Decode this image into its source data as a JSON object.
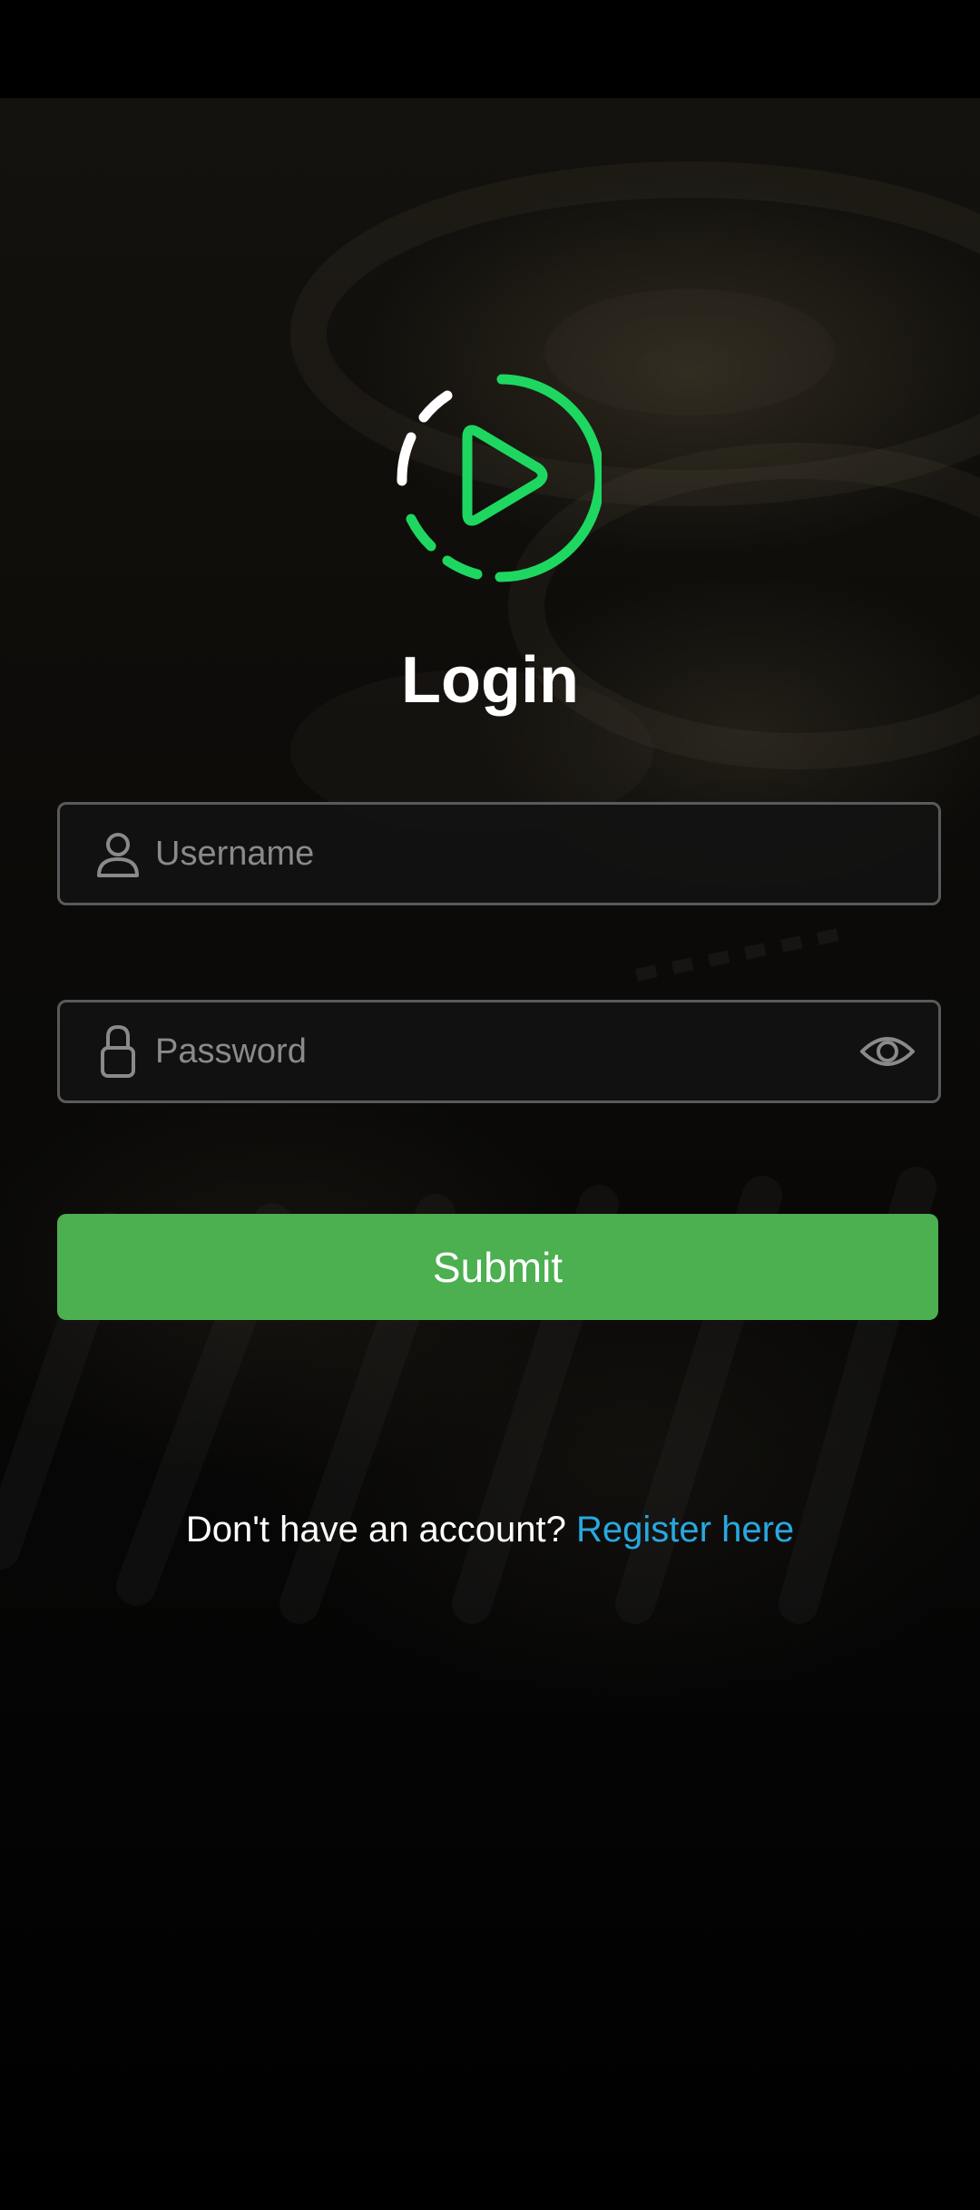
{
  "app": {
    "logo_icon": "play-circle-icon",
    "accent_color": "#1ed760",
    "title": "Login"
  },
  "form": {
    "username": {
      "placeholder": "Username",
      "value": "",
      "icon": "user-icon"
    },
    "password": {
      "placeholder": "Password",
      "value": "",
      "icon": "lock-icon",
      "toggle_icon": "eye-icon"
    },
    "submit_label": "Submit",
    "submit_color": "#4caf50"
  },
  "footer": {
    "prompt": "Don't have an account?",
    "link_label": "Register here",
    "link_color": "#29a8e0"
  }
}
